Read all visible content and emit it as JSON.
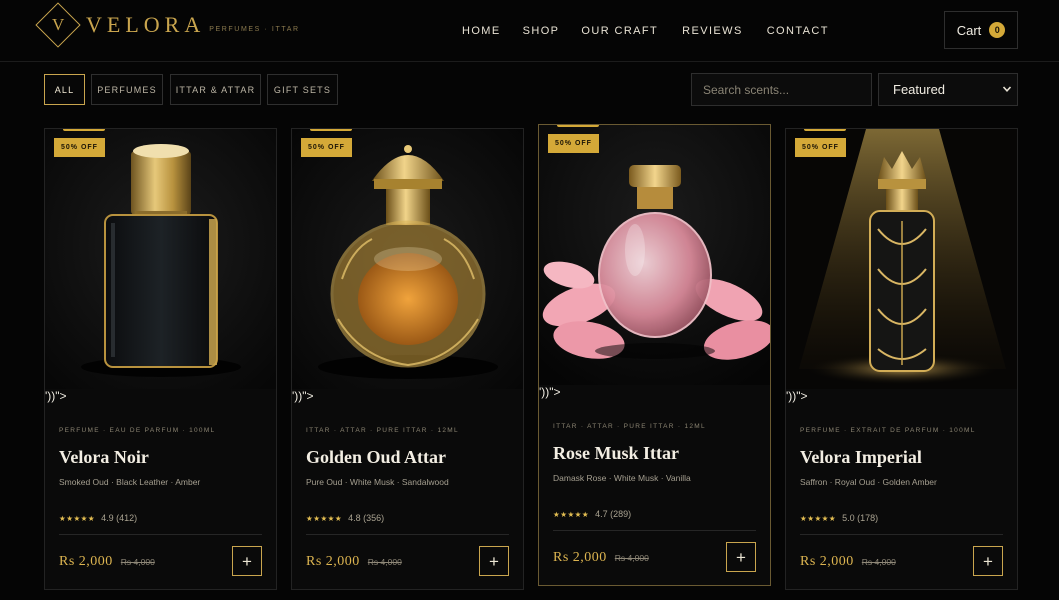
{
  "brand": {
    "mark": "V",
    "name": "VELORA",
    "tagline": "PERFUMES · ITTAR",
    "color": "#c9a54e"
  },
  "nav": {
    "items": [
      {
        "label": "HOME"
      },
      {
        "label": "SHOP"
      },
      {
        "label": "OUR CRAFT"
      },
      {
        "label": "REVIEWS"
      },
      {
        "label": "CONTACT"
      }
    ]
  },
  "cart": {
    "label": "Cart",
    "count": "0",
    "badge_color": "#d4a938"
  },
  "filters": {
    "items": [
      {
        "label": "ALL",
        "active": true
      },
      {
        "label": "PERFUMES",
        "active": false
      },
      {
        "label": "ITTAR & ATTAR",
        "active": false
      },
      {
        "label": "GIFT SETS",
        "active": false
      }
    ]
  },
  "search": {
    "placeholder": "Search scents...",
    "value": ""
  },
  "sort": {
    "selected": "Featured"
  },
  "products": [
    {
      "badge": "50% OFF",
      "glitch_text": "'))\">",
      "meta": "PERFUME · EAU DE PARFUM · 100ML",
      "name": "Velora Noir",
      "notes": "Smoked Oud · Black Leather · Amber",
      "stars": "★★★★★",
      "rating": "4.9 (412)",
      "price": "Rs 2,000",
      "old_price": "Rs 4,000",
      "add_label": "+",
      "image_icon": "black-glass-perfume-bottle"
    },
    {
      "badge": "50% OFF",
      "glitch_text": "'))\">",
      "meta": "ITTAR · ATTAR · PURE ITTAR · 12ML",
      "name": "Golden Oud Attar",
      "notes": "Pure Oud · White Musk · Sandalwood",
      "stars": "★★★★★",
      "rating": "4.8 (356)",
      "price": "Rs 2,000",
      "old_price": "Rs 4,000",
      "add_label": "+",
      "image_icon": "ornate-gold-attar-bottle"
    },
    {
      "badge": "50% OFF",
      "glitch_text": "'))\">",
      "meta": "ITTAR · ATTAR · PURE ITTAR · 12ML",
      "name": "Rose Musk Ittar",
      "notes": "Damask Rose · White Musk · Vanilla",
      "stars": "★★★★★",
      "rating": "4.7 (289)",
      "price": "Rs 2,000",
      "old_price": "Rs 4,000",
      "add_label": "+",
      "image_icon": "pink-glass-bottle-with-rose-petals"
    },
    {
      "badge": "50% OFF",
      "glitch_text": "'))\">",
      "meta": "PERFUME · EXTRAIT DE PARFUM · 100ML",
      "name": "Velora Imperial",
      "notes": "Saffron · Royal Oud · Golden Amber",
      "stars": "★★★★★",
      "rating": "5.0 (178)",
      "price": "Rs 2,000",
      "old_price": "Rs 4,000",
      "add_label": "+",
      "image_icon": "crowned-filigree-bottle-under-spotlight"
    }
  ]
}
